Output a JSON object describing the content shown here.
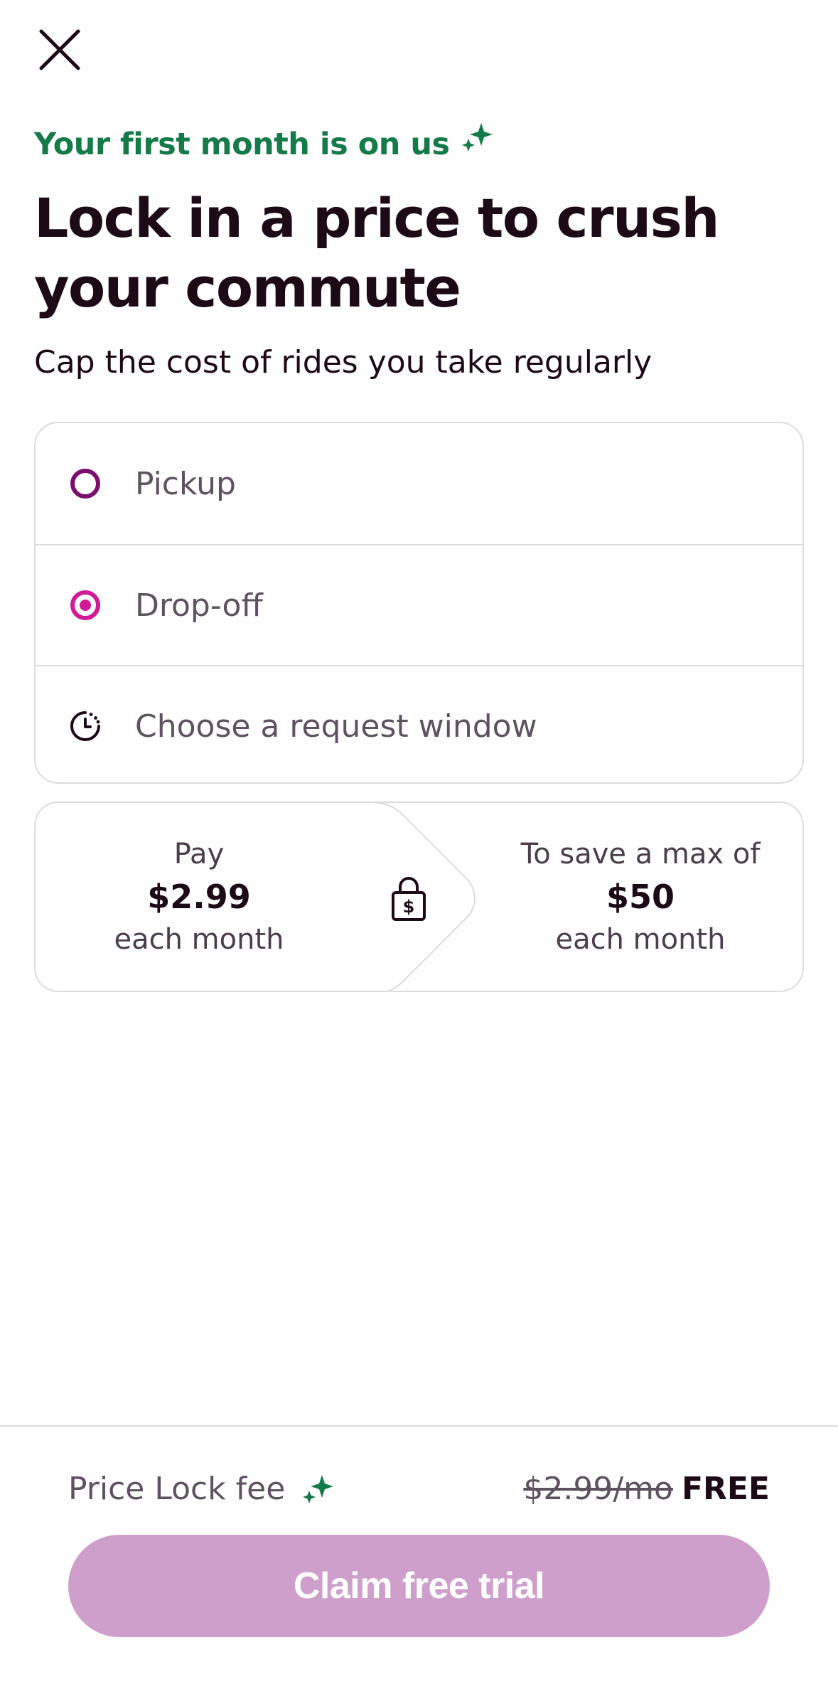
{
  "header": {
    "close_icon": "close-icon"
  },
  "intro": {
    "eyebrow": "Your first month is on us",
    "headline_line1": "Lock in a price to crush",
    "headline_line2": "your commute",
    "subhead": "Cap the cost of rides you take regularly"
  },
  "route": {
    "pickup_label": "Pickup",
    "dropoff_label": "Drop-off",
    "window_label": "Choose a request window"
  },
  "price": {
    "pay_label": "Pay",
    "pay_amount": "$2.99",
    "pay_period": "each month",
    "save_label": "To save a max of",
    "save_amount": "$50",
    "save_period": "each month"
  },
  "footer": {
    "fee_label": "Price Lock fee",
    "fee_original": "$2.99/mo",
    "fee_now": "FREE",
    "cta_label": "Claim free trial"
  },
  "colors": {
    "accent_green": "#157a4a",
    "pickup_ring": "#7a0f6e",
    "dropoff_target": "#d21996",
    "cta_disabled": "#cf9fcb"
  }
}
